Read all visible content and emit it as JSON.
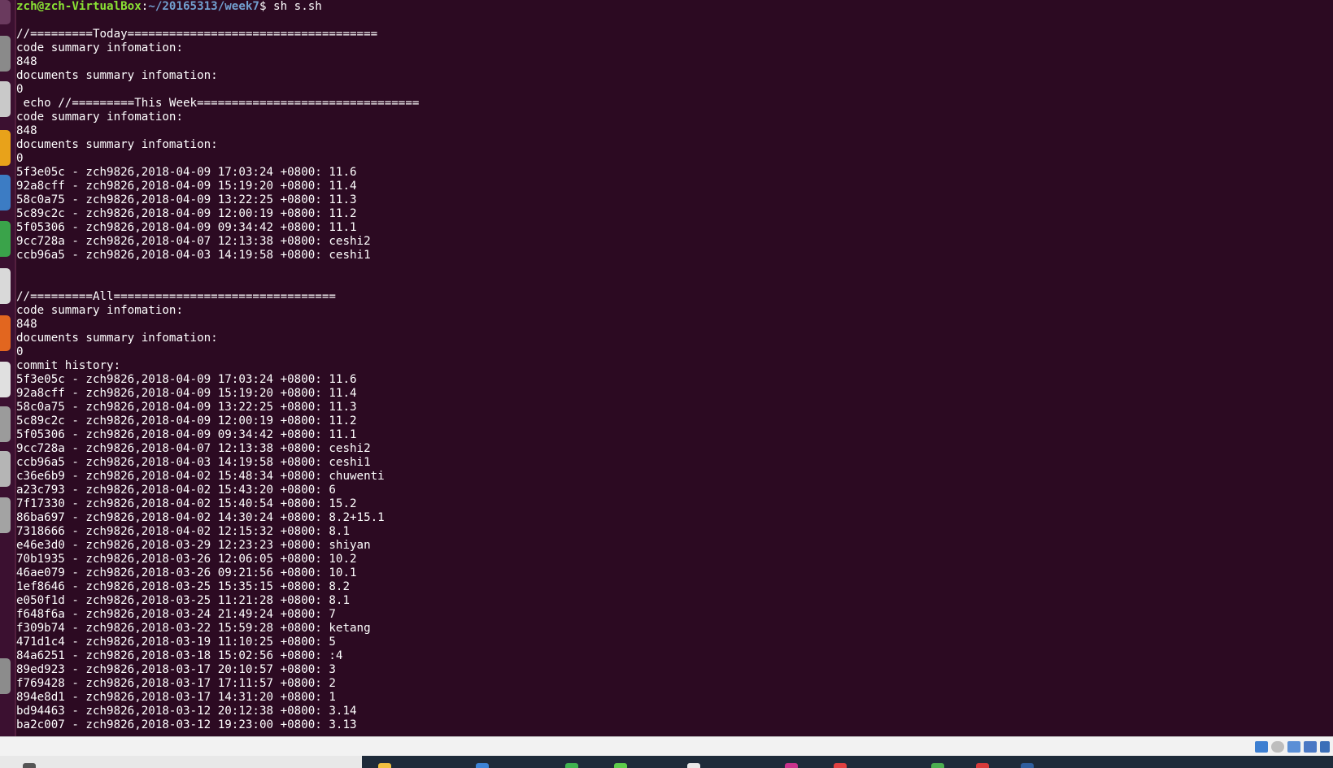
{
  "prompt": {
    "user_host": "zch@zch-VirtualBox",
    "path": "~/20165313/week7",
    "command": "$ sh s.sh"
  },
  "lines": [
    "",
    "//=========Today====================================",
    "code summary infomation:",
    "848",
    "documents summary infomation:",
    "0",
    " echo //=========This Week================================",
    "code summary infomation:",
    "848",
    "documents summary infomation:",
    "0",
    "5f3e05c - zch9826,2018-04-09 17:03:24 +0800: 11.6",
    "92a8cff - zch9826,2018-04-09 15:19:20 +0800: 11.4",
    "58c0a75 - zch9826,2018-04-09 13:22:25 +0800: 11.3",
    "5c89c2c - zch9826,2018-04-09 12:00:19 +0800: 11.2",
    "5f05306 - zch9826,2018-04-09 09:34:42 +0800: 11.1",
    "9cc728a - zch9826,2018-04-07 12:13:38 +0800: ceshi2",
    "ccb96a5 - zch9826,2018-04-03 14:19:58 +0800: ceshi1",
    "",
    "",
    "//=========All================================",
    "code summary infomation:",
    "848",
    "documents summary infomation:",
    "0",
    "commit history:",
    "5f3e05c - zch9826,2018-04-09 17:03:24 +0800: 11.6",
    "92a8cff - zch9826,2018-04-09 15:19:20 +0800: 11.4",
    "58c0a75 - zch9826,2018-04-09 13:22:25 +0800: 11.3",
    "5c89c2c - zch9826,2018-04-09 12:00:19 +0800: 11.2",
    "5f05306 - zch9826,2018-04-09 09:34:42 +0800: 11.1",
    "9cc728a - zch9826,2018-04-07 12:13:38 +0800: ceshi2",
    "ccb96a5 - zch9826,2018-04-03 14:19:58 +0800: ceshi1",
    "c36e6b9 - zch9826,2018-04-02 15:48:34 +0800: chuwenti",
    "a23c793 - zch9826,2018-04-02 15:43:20 +0800: 6",
    "7f17330 - zch9826,2018-04-02 15:40:54 +0800: 15.2",
    "86ba697 - zch9826,2018-04-02 14:30:24 +0800: 8.2+15.1",
    "7318666 - zch9826,2018-04-02 12:15:32 +0800: 8.1",
    "e46e3d0 - zch9826,2018-03-29 12:23:23 +0800: shiyan",
    "70b1935 - zch9826,2018-03-26 12:06:05 +0800: 10.2",
    "46ae079 - zch9826,2018-03-26 09:21:56 +0800: 10.1",
    "1ef8646 - zch9826,2018-03-25 15:35:15 +0800: 8.2",
    "e050f1d - zch9826,2018-03-25 11:21:28 +0800: 8.1",
    "f648f6a - zch9826,2018-03-24 21:49:24 +0800: 7",
    "f309b74 - zch9826,2018-03-22 15:59:28 +0800: ketang",
    "471d1c4 - zch9826,2018-03-19 11:10:25 +0800: 5",
    "84a6251 - zch9826,2018-03-18 15:02:56 +0800: :4",
    "89ed923 - zch9826,2018-03-17 20:10:57 +0800: 3",
    "f769428 - zch9826,2018-03-17 17:11:57 +0800: 2",
    "894e8d1 - zch9826,2018-03-17 14:31:20 +0800: 1",
    "bd94463 - zch9826,2018-03-12 20:12:38 +0800: 3.14",
    "ba2c007 - zch9826,2018-03-12 19:23:00 +0800: 3.13"
  ],
  "colors": {
    "terminal_bg": "#2c0a22",
    "terminal_fg": "#ffffff",
    "prompt_user": "#8ae234",
    "prompt_path": "#729fcf"
  },
  "launcher_icons": [
    "files-icon",
    "browser-icon",
    "office-writer-icon",
    "office-calc-icon",
    "office-impress-icon",
    "software-center-icon",
    "settings-icon",
    "trash-icon"
  ],
  "status_icons": [
    "network-icon",
    "optical-drive-icon",
    "usb-icon",
    "display-icon",
    "mouse-integration-icon"
  ]
}
